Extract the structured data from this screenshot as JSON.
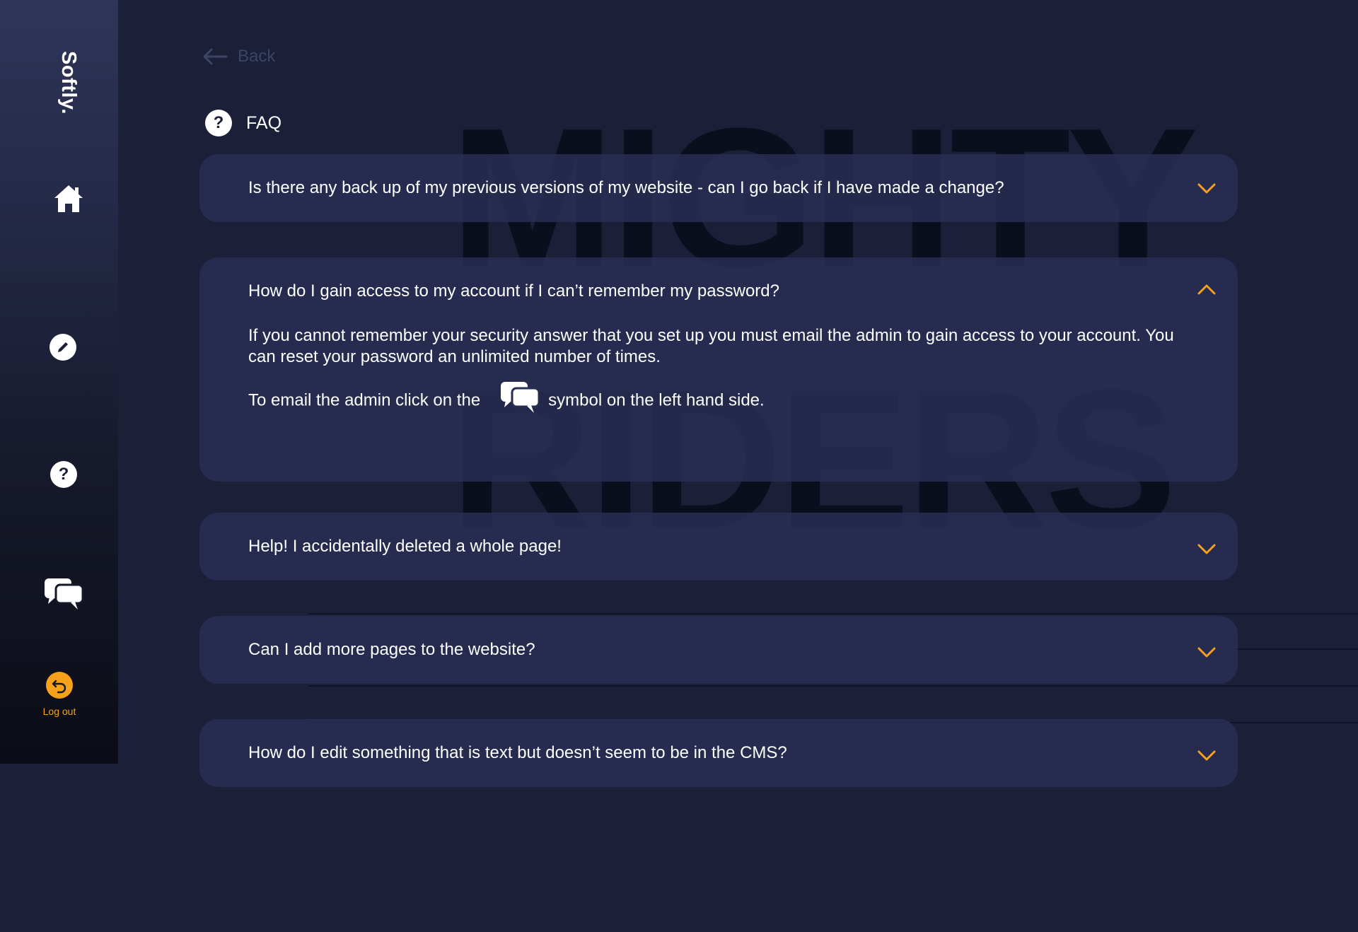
{
  "brand": "Softly.",
  "sidebar": {
    "items": [
      {
        "icon": "home-icon"
      },
      {
        "icon": "pencil-icon"
      },
      {
        "icon": "question-icon",
        "glyph": "?"
      },
      {
        "icon": "chat-icon"
      }
    ],
    "logout_label": "Log out"
  },
  "watermark": {
    "line1": "MIGHTY",
    "line2": "RIDERS"
  },
  "header": {
    "back_label": "Back",
    "title": "FAQ",
    "title_icon_glyph": "?"
  },
  "faq": {
    "items": [
      {
        "question": "Is there any back up of my previous versions of my website - can I go back if I have made a change?",
        "expanded": false
      },
      {
        "question": "How do I gain access to my account if I can’t remember my password?",
        "expanded": true,
        "answer_p1": "If you cannot remember your security answer that you set up you must email the admin to gain access to your account. You can reset your password an unlimited number of times.",
        "answer_p2_before": "To email the admin click on the",
        "answer_p2_after": "symbol on the left hand side."
      },
      {
        "question": "Help! I accidentally deleted a whole page!",
        "expanded": false
      },
      {
        "question": "Can I add more pages to the website?",
        "expanded": false
      },
      {
        "question": "How do I edit something that is text but doesn’t seem to be in the CMS?",
        "expanded": false
      }
    ]
  },
  "colors": {
    "accent": "#f7a11a",
    "background": "#1b1f38",
    "card": "#282e52",
    "watermark": "#0b0e1c"
  }
}
